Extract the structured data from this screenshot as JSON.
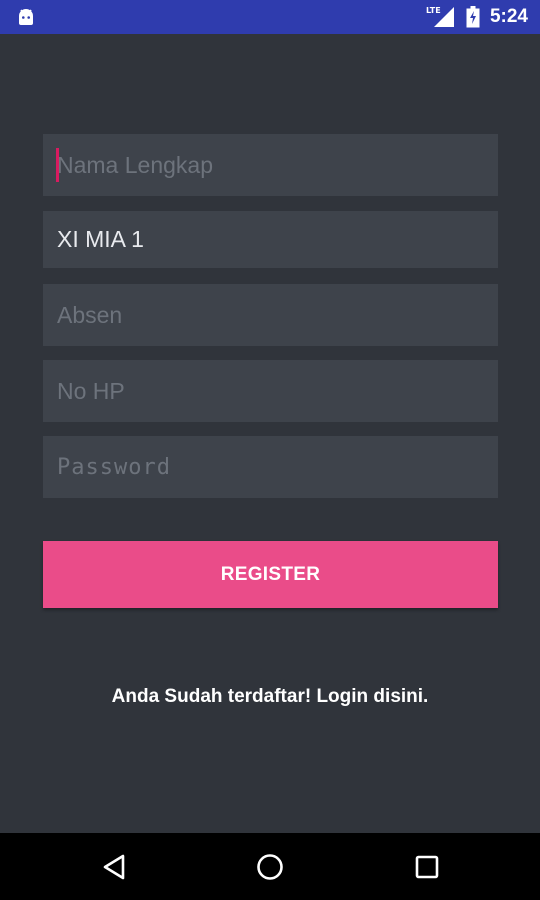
{
  "status_bar": {
    "network_label": "LTE",
    "time": "5:24",
    "background": "#2f3cae",
    "left_icon": "android-icon",
    "signal_icon": "cell-signal-icon",
    "battery_icon": "battery-icon"
  },
  "form": {
    "full_name": {
      "value": "",
      "placeholder": "Nama Lengkap"
    },
    "class": {
      "value": "XI MIA 1",
      "placeholder": ""
    },
    "absen": {
      "value": "",
      "placeholder": "Absen"
    },
    "phone": {
      "value": "",
      "placeholder": "No HP"
    },
    "password": {
      "value": "",
      "placeholder": "Password"
    },
    "register_label": "REGISTER",
    "login_link": "Anda Sudah terdaftar! Login disini."
  },
  "colors": {
    "background": "#30343b",
    "field_background": "#3e434b",
    "accent": "#ea4c89",
    "cursor": "#d81b60"
  },
  "nav_bar": {
    "back_icon": "back-triangle-icon",
    "home_icon": "home-circle-icon",
    "recents_icon": "recents-square-icon"
  }
}
